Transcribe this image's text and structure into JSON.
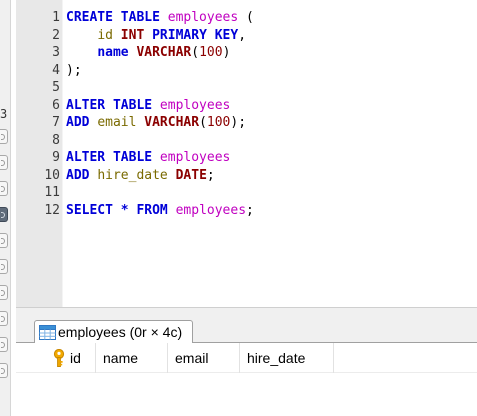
{
  "sidebar": {
    "partial_number": "3"
  },
  "editor": {
    "lines": [
      {
        "no": "1",
        "tokens": [
          {
            "t": "kw",
            "v": "CREATE TABLE"
          },
          {
            "t": "pl",
            "v": " "
          },
          {
            "t": "id",
            "v": "employees"
          },
          {
            "t": "pl",
            "v": " ("
          }
        ]
      },
      {
        "no": "2",
        "tokens": [
          {
            "t": "pl",
            "v": "    "
          },
          {
            "t": "col",
            "v": "id"
          },
          {
            "t": "pl",
            "v": " "
          },
          {
            "t": "type",
            "v": "INT"
          },
          {
            "t": "pl",
            "v": " "
          },
          {
            "t": "kw",
            "v": "PRIMARY KEY"
          },
          {
            "t": "pl",
            "v": ","
          }
        ]
      },
      {
        "no": "3",
        "tokens": [
          {
            "t": "pl",
            "v": "    "
          },
          {
            "t": "kw",
            "v": "name"
          },
          {
            "t": "pl",
            "v": " "
          },
          {
            "t": "type",
            "v": "VARCHAR"
          },
          {
            "t": "pl",
            "v": "("
          },
          {
            "t": "num",
            "v": "100"
          },
          {
            "t": "pl",
            "v": ")"
          }
        ]
      },
      {
        "no": "4",
        "tokens": [
          {
            "t": "pl",
            "v": ");"
          }
        ]
      },
      {
        "no": "5",
        "tokens": []
      },
      {
        "no": "6",
        "tokens": [
          {
            "t": "kw",
            "v": "ALTER TABLE"
          },
          {
            "t": "pl",
            "v": " "
          },
          {
            "t": "id",
            "v": "employees"
          }
        ]
      },
      {
        "no": "7",
        "tokens": [
          {
            "t": "kw",
            "v": "ADD"
          },
          {
            "t": "pl",
            "v": " "
          },
          {
            "t": "col",
            "v": "email"
          },
          {
            "t": "pl",
            "v": " "
          },
          {
            "t": "type",
            "v": "VARCHAR"
          },
          {
            "t": "pl",
            "v": "("
          },
          {
            "t": "num",
            "v": "100"
          },
          {
            "t": "pl",
            "v": ");"
          }
        ]
      },
      {
        "no": "8",
        "tokens": []
      },
      {
        "no": "9",
        "tokens": [
          {
            "t": "kw",
            "v": "ALTER TABLE"
          },
          {
            "t": "pl",
            "v": " "
          },
          {
            "t": "id",
            "v": "employees"
          }
        ]
      },
      {
        "no": "10",
        "tokens": [
          {
            "t": "kw",
            "v": "ADD"
          },
          {
            "t": "pl",
            "v": " "
          },
          {
            "t": "col",
            "v": "hire_date"
          },
          {
            "t": "pl",
            "v": " "
          },
          {
            "t": "type",
            "v": "DATE"
          },
          {
            "t": "pl",
            "v": ";"
          }
        ]
      },
      {
        "no": "11",
        "tokens": []
      },
      {
        "no": "12",
        "tokens": [
          {
            "t": "kw",
            "v": "SELECT"
          },
          {
            "t": "pl",
            "v": " "
          },
          {
            "t": "kw",
            "v": "*"
          },
          {
            "t": "pl",
            "v": " "
          },
          {
            "t": "kw",
            "v": "FROM"
          },
          {
            "t": "pl",
            "v": " "
          },
          {
            "t": "id",
            "v": "employees"
          },
          {
            "t": "pl",
            "v": ";"
          }
        ]
      }
    ]
  },
  "results": {
    "tab_label": "employees (0r × 4c)",
    "columns": [
      "id",
      "name",
      "email",
      "hire_date"
    ]
  },
  "icons": {
    "table": "table-icon",
    "primary_key": "key-icon"
  },
  "colors": {
    "keyword": "#0000d8",
    "identifier": "#c000c0",
    "type": "#8b0000",
    "column": "#7a6a00",
    "gutter_bg": "#e8e8e8",
    "key_icon": "#f2a900",
    "table_icon": "#3a8fd6"
  }
}
